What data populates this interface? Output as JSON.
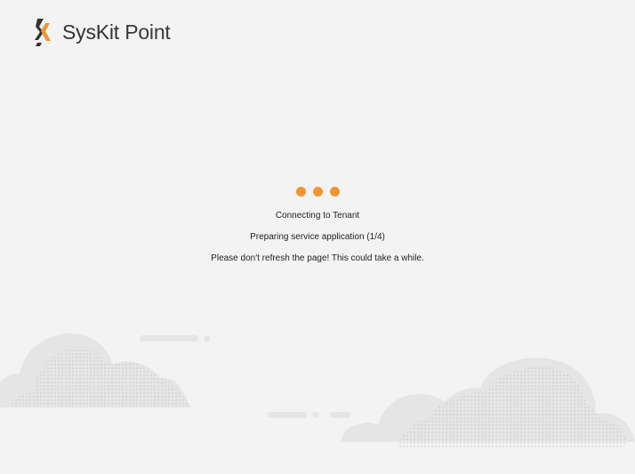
{
  "brand": {
    "name": "SysKit",
    "product": "Point",
    "accent_color": "#f39432",
    "mark_color_dark": "#333333"
  },
  "loader": {
    "dot_count": 3,
    "dot_color": "#f39432"
  },
  "status": {
    "title": "Connecting to Tenant",
    "step": "Preparing service application (1/4)",
    "notice": "Please don't refresh the page! This could take a while."
  },
  "decoration": {
    "icon": "clouds-illustration",
    "cloud_color": "#e4e4e4",
    "pattern_color": "#cfcfcf"
  }
}
